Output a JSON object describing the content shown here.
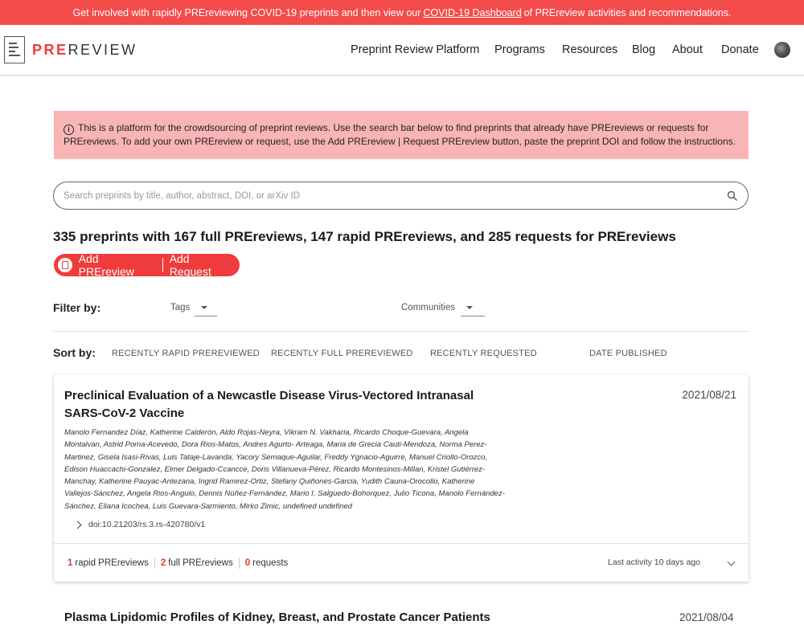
{
  "banner": {
    "text_before": "Get involved with rapidly PREreviewing COVID-19 preprints and then view our",
    "link": "COVID-19 Dashboard",
    "text_after": "of PREreview activities and recommendations."
  },
  "header": {
    "logo_pre": "PRE",
    "logo_rest": "REVIEW",
    "nav": [
      {
        "label": "Preprint Review Platform"
      },
      {
        "label": "Programs"
      },
      {
        "label": "Resources"
      },
      {
        "label": "Blog"
      },
      {
        "label": "About"
      },
      {
        "label": "Donate"
      }
    ]
  },
  "notice": {
    "text": "This is a platform for the crowdsourcing of preprint reviews. Use the search bar below to find preprints that already have PREreviews or requests for PREreviews. To add your own PREreview or request, use the Add PREreview | Request PREreview button, paste the preprint DOI and follow the instructions."
  },
  "search": {
    "placeholder": "Search preprints by title, author, abstract, DOI, or arXiv ID"
  },
  "summary": "335 preprints with 167 full PREreviews, 147 rapid PREreviews, and 285 requests for PREreviews",
  "actions": {
    "add_prereview": "Add PREreview",
    "add_request": "Add Request"
  },
  "filter": {
    "label": "Filter by:",
    "tags": "Tags",
    "communities": "Communities"
  },
  "sort": {
    "label": "Sort by:",
    "options": [
      "RECENTLY RAPID PREREVIEWED",
      "RECENTLY FULL PREREVIEWED",
      "RECENTLY REQUESTED",
      "DATE PUBLISHED"
    ]
  },
  "preprints": [
    {
      "title": "Preclinical Evaluation of a Newcastle Disease Virus-Vectored Intranasal SARS-CoV-2 Vaccine",
      "date": "2021/08/21",
      "authors": "Manolo Fernandez Díaz, Katherine Calderón, Aldo Rojas-Neyra, Vikram N. Vakharia, Ricardo Choque-Guevara, Angela Montalvan, Astrid Poma-Acevedo, Dora Rios-Matos, Andres Agurto- Arteaga, Maria de Grecia Cauti-Mendoza, Norma Perez-Martinez, Gisela Isasi-Rivas, Luis Tataje-Lavanda, Yacory Sernaque-Aguilar, Freddy Ygnacio-Aguirre, Manuel Criollo-Orozco, Edison Huaccachi-Gonzalez, Elmer Delgado-Ccancce, Doris Villanueva-Pérez, Ricardo Montesinos-Millan, Kristel Gutiérrez-Manchay, Katherine Pauyac-Antezana, Ingrid Ramirez-Ortiz, Stefany Quiñones-Garcia, Yudith Cauna-Orocollo, Katherine Vallejos-Sánchez, Angela Rios-Angulo, Dennis Núñez-Fernández, Mario I. Salguedo-Bohorquez, Julio Ticona, Manolo Fernández-Sánchez, Eliana Icochea, Luis Guevara-Sarmiento, Mirko Zimic, undefined undefined",
      "doi": "doi:10.21203/rs.3.rs-420780/v1",
      "rapid_count": "1",
      "rapid_label": "rapid PREreviews",
      "full_count": "2",
      "full_label": "full PREreviews",
      "request_count": "0",
      "request_label": "requests",
      "last_activity": "Last activity 10 days ago"
    },
    {
      "title": "Plasma Lipidomic Profiles of Kidney, Breast, and Prostate Cancer Patients",
      "date": "2021/08/04"
    }
  ],
  "colors": {
    "brand_red": "#ef3b3b",
    "banner_red": "#f44b4b",
    "notice_bg": "#f9b5b5"
  }
}
